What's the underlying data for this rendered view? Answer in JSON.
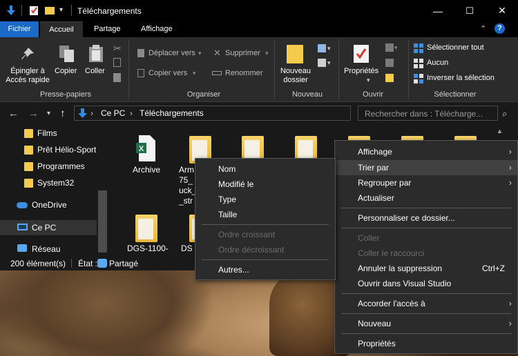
{
  "window": {
    "title": "Téléchargements",
    "controls": {
      "minimize": "—",
      "maximize": "☐",
      "close": "✕"
    }
  },
  "tabs": [
    "Fichier",
    "Accueil",
    "Partage",
    "Affichage"
  ],
  "ribbon": {
    "presse_papiers": {
      "group": "Presse-papiers",
      "pin_line1": "Épingler à",
      "pin_line2": "Accès rapide",
      "copy": "Copier",
      "paste": "Coller"
    },
    "organiser": {
      "group": "Organiser",
      "move_to": "Déplacer vers",
      "copy_to": "Copier vers",
      "delete": "Supprimer",
      "rename": "Renommer"
    },
    "nouveau": {
      "group": "Nouveau",
      "new_folder_line1": "Nouveau",
      "new_folder_line2": "dossier"
    },
    "ouvrir": {
      "group": "Ouvrir",
      "properties": "Propriétés"
    },
    "selectionner": {
      "group": "Sélectionner",
      "select_all": "Sélectionner tout",
      "none": "Aucun",
      "invert": "Inverser la sélection"
    }
  },
  "address": {
    "crumbs": [
      "Ce PC",
      "Téléchargements"
    ],
    "search_placeholder": "Rechercher dans : Télécharge..."
  },
  "nav_pane": {
    "items": [
      "Films",
      "Prêt Hélio-Sport",
      "Programmes",
      "System32",
      "OneDrive",
      "Ce PC",
      "Réseau"
    ]
  },
  "files": {
    "archive": "Archive",
    "arm": "Arm",
    "arm2": "75_",
    "arm3": "uck_",
    "arm4": "_str",
    "dgs": "DGS-1100-",
    "ds": "DS"
  },
  "status": {
    "count": "200 élément(s)",
    "state": "État :",
    "shared": "Partagé"
  },
  "context_menu": {
    "items": [
      {
        "label": "Affichage",
        "submenu": true
      },
      {
        "label": "Trier par",
        "submenu": true
      },
      {
        "label": "Regrouper par",
        "submenu": true
      },
      {
        "label": "Actualiser"
      },
      {
        "label": "Personnaliser ce dossier..."
      },
      {
        "label": "Coller",
        "disabled": true
      },
      {
        "label": "Coller le raccourci",
        "disabled": true
      },
      {
        "label": "Annuler la suppression",
        "shortcut": "Ctrl+Z"
      },
      {
        "label": "Ouvrir dans Visual Studio"
      },
      {
        "label": "Accorder l'accès à",
        "submenu": true
      },
      {
        "label": "Nouveau",
        "submenu": true
      },
      {
        "label": "Propriétés"
      }
    ]
  },
  "sort_submenu": {
    "items": [
      {
        "label": "Nom"
      },
      {
        "label": "Modifié le"
      },
      {
        "label": "Type"
      },
      {
        "label": "Taille"
      },
      {
        "label": "Ordre croissant",
        "disabled": true
      },
      {
        "label": "Ordre décroissant",
        "disabled": true
      },
      {
        "label": "Autres..."
      }
    ]
  },
  "colors": {
    "accent": "#1b6ac9",
    "folder": "#f6ca4b"
  }
}
